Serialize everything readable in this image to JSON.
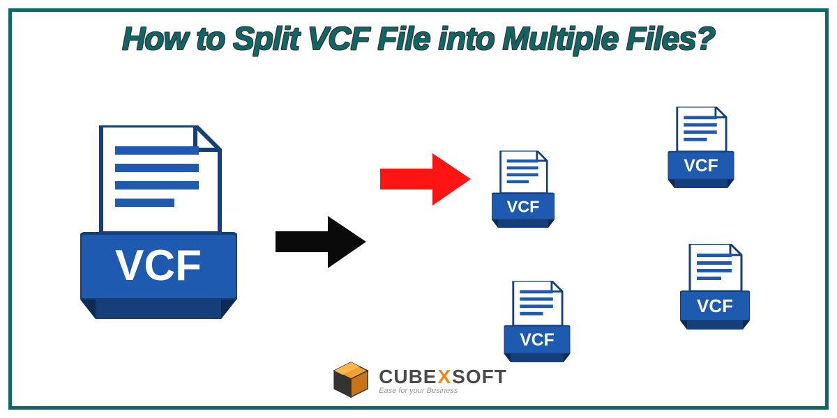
{
  "title": "How to Split VCF File into Multiple Files?",
  "big_icon_label": "VCF",
  "small_icons": [
    "VCF",
    "VCF",
    "VCF",
    "VCF"
  ],
  "logo": {
    "part1": "CUBE",
    "x": "X",
    "part2": "SOFT",
    "tagline": "Ease for your Business"
  },
  "colors": {
    "teal": "#0e6666",
    "file_blue": "#1e5bb0",
    "file_stroke": "#163f7a",
    "arrow_black": "#0a0a0a",
    "arrow_red": "#ff1414",
    "cube_orange": "#e88b1a"
  }
}
